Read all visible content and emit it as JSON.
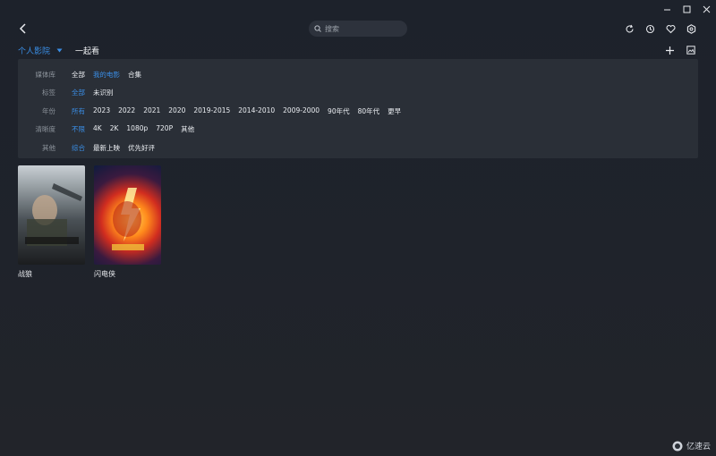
{
  "search": {
    "placeholder": "搜索"
  },
  "tabs": [
    {
      "label": "个人影院",
      "active": true
    },
    {
      "label": "一起看",
      "active": false
    }
  ],
  "filters": [
    {
      "label": "媒体库",
      "options": [
        "全部",
        "我的电影",
        "合集"
      ],
      "selected": 1
    },
    {
      "label": "标签",
      "options": [
        "全部",
        "未识别"
      ],
      "selected": 0
    },
    {
      "label": "年份",
      "options": [
        "所有",
        "2023",
        "2022",
        "2021",
        "2020",
        "2019-2015",
        "2014-2010",
        "2009-2000",
        "90年代",
        "80年代",
        "更早"
      ],
      "selected": 0
    },
    {
      "label": "清晰度",
      "options": [
        "不限",
        "4K",
        "2K",
        "1080p",
        "720P",
        "其他"
      ],
      "selected": 0
    },
    {
      "label": "其他",
      "options": [
        "综合",
        "最新上映",
        "优先好评"
      ],
      "selected": 0
    }
  ],
  "movies": [
    {
      "title": "战狼"
    },
    {
      "title": "闪电侠"
    }
  ],
  "colors": {
    "accent": "#3a8ee6",
    "panel": "#2a2f37",
    "background": "#1f232b"
  },
  "icons": {
    "titlebar": [
      "minimize-icon",
      "maximize-icon",
      "close-icon"
    ],
    "top_actions": [
      "refresh-icon",
      "history-icon",
      "favorite-icon",
      "settings-icon"
    ],
    "tools": [
      "add-icon",
      "image-icon"
    ]
  },
  "logo": {
    "text": "亿速云"
  }
}
